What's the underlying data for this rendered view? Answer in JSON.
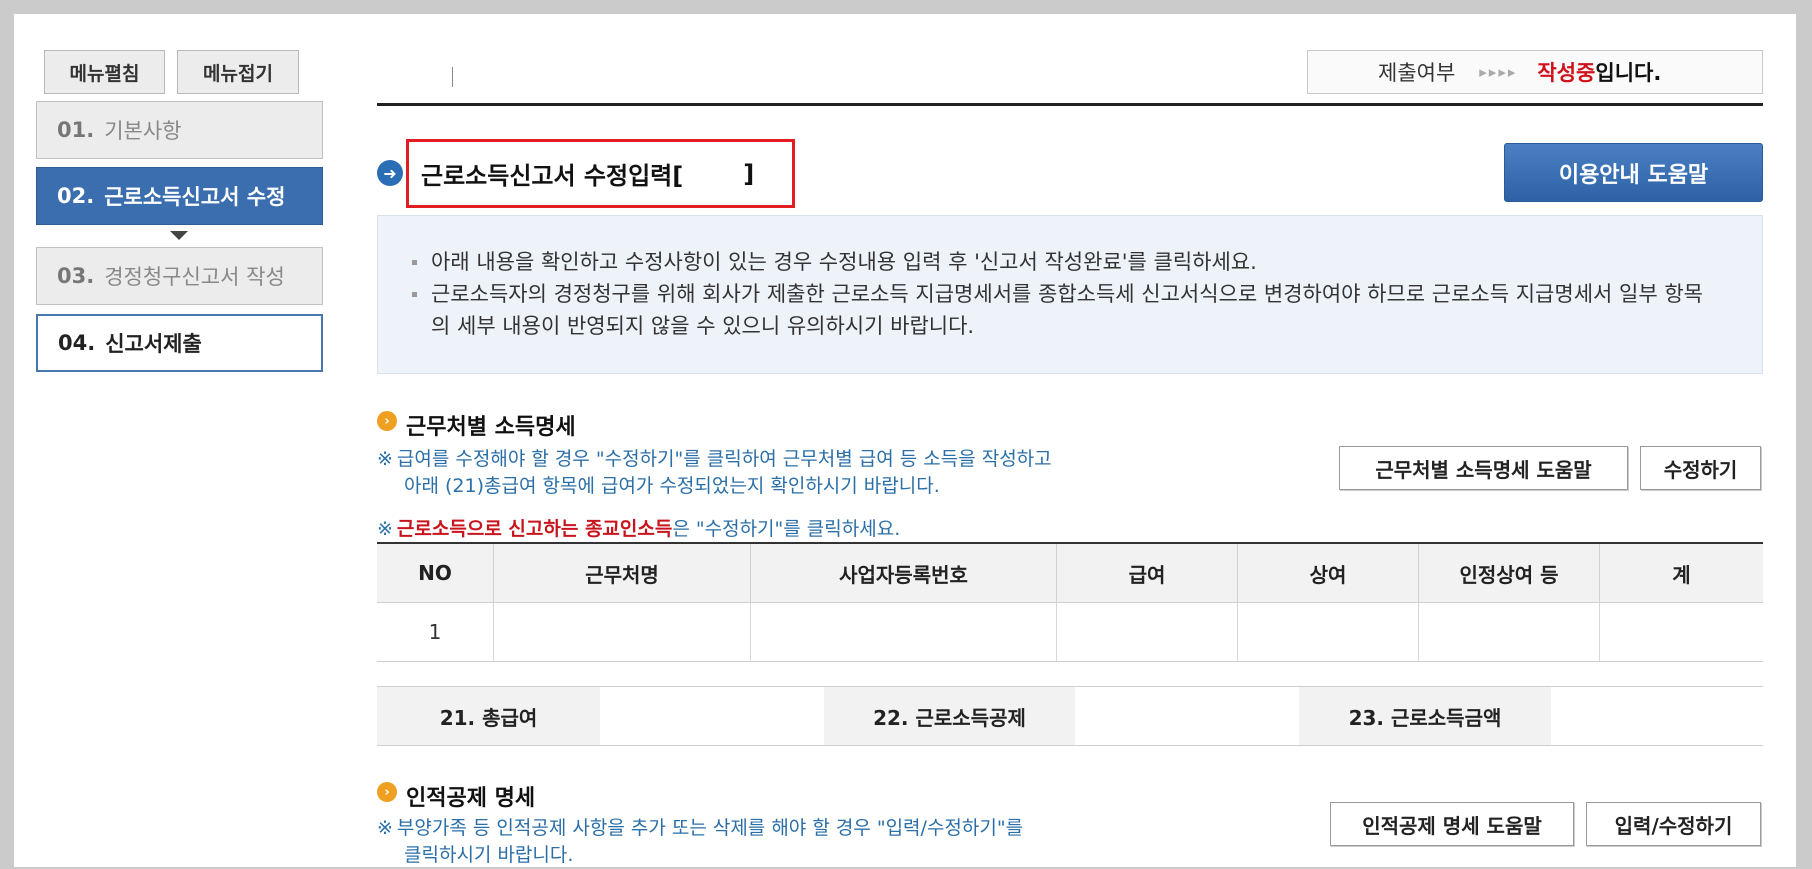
{
  "nav": {
    "expand_label": "메뉴펼침",
    "collapse_label": "메뉴접기",
    "steps": [
      {
        "num": "01.",
        "label": "기본사항"
      },
      {
        "num": "02.",
        "label": "근로소득신고서 수정"
      },
      {
        "num": "03.",
        "label": "경정청구신고서 작성"
      },
      {
        "num": "04.",
        "label": "신고서제출"
      }
    ]
  },
  "status": {
    "label": "제출여부",
    "arrows": "▸▸▸▸",
    "value_highlight": "작성중",
    "value_rest": "입니다."
  },
  "title": {
    "icon": "➜",
    "text": "근로소득신고서 수정입력[",
    "bracket_close": "]"
  },
  "help_button": "이용안내 도움말",
  "notice": {
    "items": [
      "아래 내용을 확인하고 수정사항이 있는 경우 수정내용 입력 후 '신고서 작성완료'를 클릭하세요.",
      "근로소득자의 경정청구를 위해 회사가 제출한 근로소득 지급명세서를 종합소득세 신고서식으로 변경하여야 하므로 근로소득 지급명세서 일부 항목의 세부 내용이 반영되지 않을 수 있으니 유의하시기 바랍니다."
    ]
  },
  "income_section": {
    "title": "근무처별 소득명세",
    "note_mark": "※",
    "note_line1": "급여를 수정해야 할 경우 \"수정하기\"를 클릭하여 근무처별 급여 등 소득을 작성하고",
    "note_line2": "아래 (21)총급여 항목에 급여가 수정되었는지 확인하시기 바랍니다.",
    "note2_red": "근로소득으로 신고하는 종교인소득",
    "note2_rest": "은 \"수정하기\"를 클릭하세요.",
    "help_button": "근무처별 소득명세 도움말",
    "edit_button": "수정하기",
    "table": {
      "headers": [
        "NO",
        "근무처명",
        "사업자등록번호",
        "급여",
        "상여",
        "인정상여 등",
        "계"
      ],
      "rows": [
        [
          "1",
          "",
          "",
          "",
          "",
          "",
          ""
        ]
      ]
    },
    "summary": {
      "total_salary": "21. 총급여",
      "deduction": "22. 근로소득공제",
      "income_amount": "23. 근로소득금액"
    }
  },
  "personal_section": {
    "title": "인적공제 명세",
    "note_mark": "※",
    "note_line1": "부양가족 등 인적공제 사항을 추가 또는 삭제를 해야 할 경우 \"입력/수정하기\"를",
    "note_line2": "클릭하시기 바랍니다.",
    "help_button": "인적공제 명세 도움말",
    "edit_button": "입력/수정하기"
  }
}
